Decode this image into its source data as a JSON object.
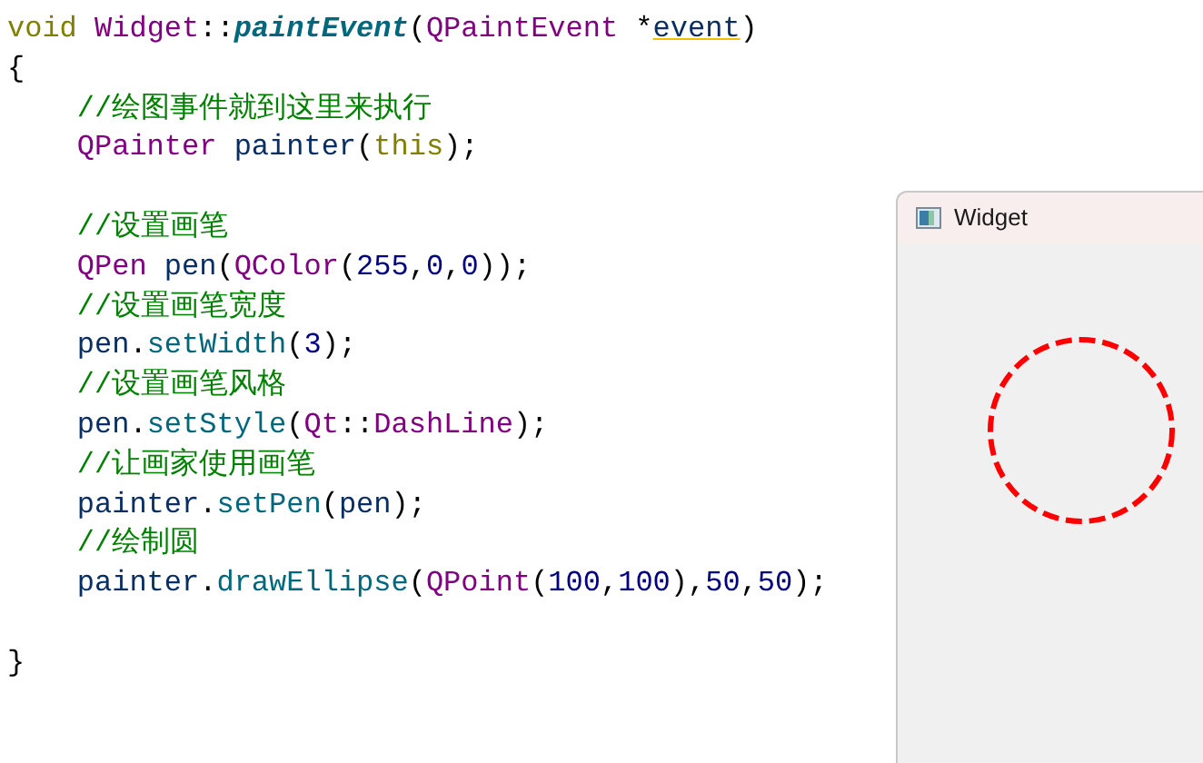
{
  "code": {
    "blocks": [
      {
        "lines": [
          {
            "indented": false,
            "tokens": [
              {
                "text": "void ",
                "kind": "keyword"
              },
              {
                "text": "Widget",
                "kind": "type"
              },
              {
                "text": "::",
                "kind": "plain"
              },
              {
                "text": "paintEvent",
                "kind": "declaration"
              },
              {
                "text": "(",
                "kind": "plain"
              },
              {
                "text": "QPaintEvent",
                "kind": "type"
              },
              {
                "text": " *",
                "kind": "plain"
              },
              {
                "text": "event",
                "kind": "unused"
              },
              {
                "text": ")",
                "kind": "plain"
              }
            ]
          },
          {
            "indented": false,
            "tokens": [
              {
                "text": "{",
                "kind": "plain"
              }
            ]
          },
          {
            "indented": true,
            "tokens": [
              {
                "text": "//绘图事件就到这里来执行",
                "kind": "comment"
              }
            ]
          },
          {
            "indented": true,
            "tokens": [
              {
                "text": "QPainter ",
                "kind": "type"
              },
              {
                "text": "painter",
                "kind": "variable"
              },
              {
                "text": "(",
                "kind": "plain"
              },
              {
                "text": "this",
                "kind": "keyword"
              },
              {
                "text": ");",
                "kind": "plain"
              }
            ]
          }
        ]
      },
      {
        "lines": [
          {
            "indented": true,
            "tokens": [
              {
                "text": "//设置画笔",
                "kind": "comment"
              }
            ]
          },
          {
            "indented": true,
            "tokens": [
              {
                "text": "QPen ",
                "kind": "type"
              },
              {
                "text": "pen",
                "kind": "variable"
              },
              {
                "text": "(",
                "kind": "plain"
              },
              {
                "text": "QColor",
                "kind": "type"
              },
              {
                "text": "(",
                "kind": "plain"
              },
              {
                "text": "255",
                "kind": "number"
              },
              {
                "text": ",",
                "kind": "plain"
              },
              {
                "text": "0",
                "kind": "number"
              },
              {
                "text": ",",
                "kind": "plain"
              },
              {
                "text": "0",
                "kind": "number"
              },
              {
                "text": "));",
                "kind": "plain"
              }
            ]
          },
          {
            "indented": true,
            "tokens": [
              {
                "text": "//设置画笔宽度",
                "kind": "comment"
              }
            ]
          },
          {
            "indented": true,
            "tokens": [
              {
                "text": "pen",
                "kind": "variable"
              },
              {
                "text": ".",
                "kind": "plain"
              },
              {
                "text": "setWidth",
                "kind": "method"
              },
              {
                "text": "(",
                "kind": "plain"
              },
              {
                "text": "3",
                "kind": "number"
              },
              {
                "text": ");",
                "kind": "plain"
              }
            ]
          },
          {
            "indented": true,
            "tokens": [
              {
                "text": "//设置画笔风格",
                "kind": "comment"
              }
            ]
          },
          {
            "indented": true,
            "tokens": [
              {
                "text": "pen",
                "kind": "variable"
              },
              {
                "text": ".",
                "kind": "plain"
              },
              {
                "text": "setStyle",
                "kind": "method"
              },
              {
                "text": "(",
                "kind": "plain"
              },
              {
                "text": "Qt",
                "kind": "type"
              },
              {
                "text": "::",
                "kind": "plain"
              },
              {
                "text": "DashLine",
                "kind": "type"
              },
              {
                "text": ");",
                "kind": "plain"
              }
            ]
          },
          {
            "indented": true,
            "tokens": [
              {
                "text": "//让画家使用画笔",
                "kind": "comment"
              }
            ]
          },
          {
            "indented": true,
            "tokens": [
              {
                "text": "painter",
                "kind": "variable"
              },
              {
                "text": ".",
                "kind": "plain"
              },
              {
                "text": "setPen",
                "kind": "method"
              },
              {
                "text": "(",
                "kind": "plain"
              },
              {
                "text": "pen",
                "kind": "variable"
              },
              {
                "text": ");",
                "kind": "plain"
              }
            ]
          },
          {
            "indented": true,
            "tokens": [
              {
                "text": "//绘制圆",
                "kind": "comment"
              }
            ]
          },
          {
            "indented": true,
            "tokens": [
              {
                "text": "painter",
                "kind": "variable"
              },
              {
                "text": ".",
                "kind": "plain"
              },
              {
                "text": "drawEllipse",
                "kind": "method"
              },
              {
                "text": "(",
                "kind": "plain"
              },
              {
                "text": "QPoint",
                "kind": "type"
              },
              {
                "text": "(",
                "kind": "plain"
              },
              {
                "text": "100",
                "kind": "number"
              },
              {
                "text": ",",
                "kind": "plain"
              },
              {
                "text": "100",
                "kind": "number"
              },
              {
                "text": "),",
                "kind": "plain"
              },
              {
                "text": "50",
                "kind": "number"
              },
              {
                "text": ",",
                "kind": "plain"
              },
              {
                "text": "50",
                "kind": "number"
              },
              {
                "text": ");",
                "kind": "plain"
              }
            ]
          }
        ]
      },
      {
        "lines": [
          {
            "indented": false,
            "tokens": [
              {
                "text": "}",
                "kind": "plain"
              }
            ]
          }
        ]
      }
    ]
  },
  "widget_window": {
    "title": "Widget"
  }
}
